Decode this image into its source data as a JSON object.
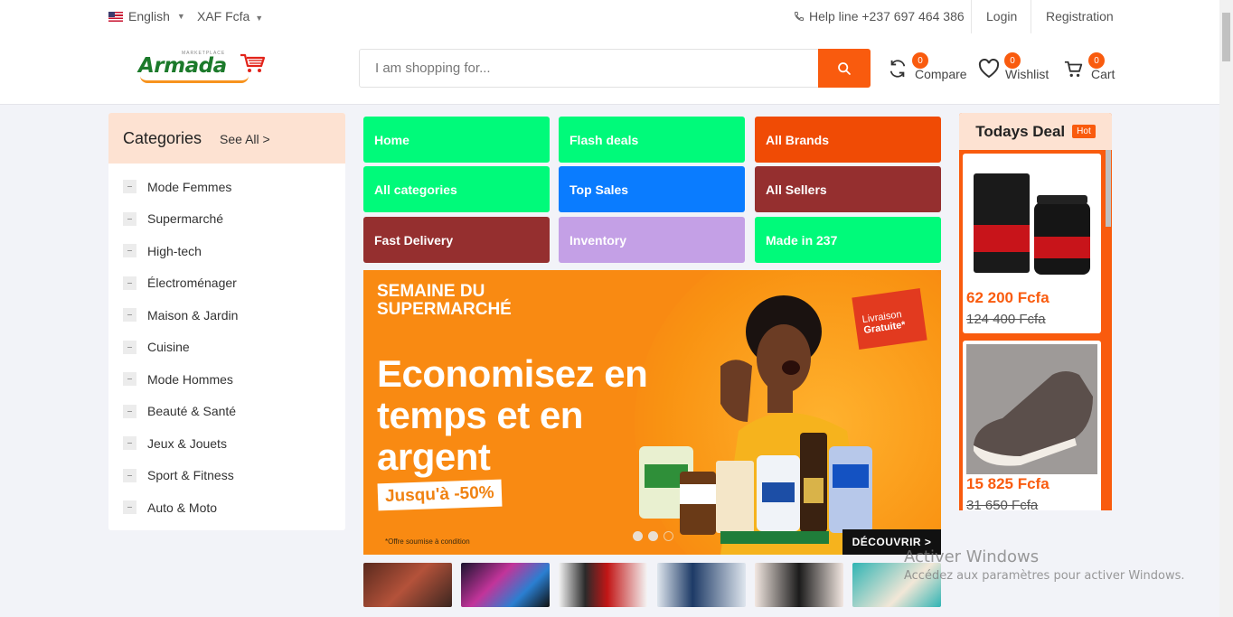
{
  "topbar": {
    "language": "English",
    "currency": "XAF Fcfa",
    "helpline": "Help line +237 697 464 386",
    "login": "Login",
    "registration": "Registration"
  },
  "header": {
    "logo_text": "Armada",
    "logo_tagline": "MARKETPLACE",
    "search_placeholder": "I am shopping for...",
    "compare": {
      "label": "Compare",
      "count": "0"
    },
    "wishlist": {
      "label": "Wishlist",
      "count": "0"
    },
    "cart": {
      "label": "Cart",
      "count": "0"
    }
  },
  "categories": {
    "title": "Categories",
    "see_all": "See All >",
    "items": [
      "Mode Femmes",
      "Supermarché",
      "High-tech",
      "Électroménager",
      "Maison & Jardin",
      "Cuisine",
      "Mode Hommes",
      "Beauté & Santé",
      "Jeux & Jouets",
      "Sport & Fitness",
      "Auto & Moto"
    ]
  },
  "nav_tiles": [
    {
      "label": "Home",
      "color": "#00fa7a"
    },
    {
      "label": "Flash deals",
      "color": "#00fa7a"
    },
    {
      "label": "All Brands",
      "color": "#f04b05"
    },
    {
      "label": "All categories",
      "color": "#00fa7a"
    },
    {
      "label": "Top Sales",
      "color": "#0a7cff"
    },
    {
      "label": "All Sellers",
      "color": "#952f2f"
    },
    {
      "label": "Fast Delivery",
      "color": "#952f2f"
    },
    {
      "label": "Inventory",
      "color": "#c4a0e6"
    },
    {
      "label": "Made in 237",
      "color": "#00fa7a"
    }
  ],
  "banner": {
    "headline_small": "SEMAINE DU SUPERMARCHÉ",
    "headline_big": "Economisez en temps et en argent",
    "discount": "Jusqu'à -50%",
    "note": "*Offre soumise à condition",
    "delivery_line1": "Livraison",
    "delivery_line2": "Gratuite*",
    "cta": "DÉCOUVRIR >"
  },
  "todays_deal": {
    "title": "Todays Deal",
    "badge": "Hot",
    "products": [
      {
        "price": "62 200 Fcfa",
        "old_price": "124 400 Fcfa"
      },
      {
        "price": "15 825 Fcfa",
        "old_price": "31 650 Fcfa"
      }
    ]
  },
  "watermark": {
    "line1": "Activer Windows",
    "line2": "Accédez aux paramètres pour activer Windows."
  },
  "colors": {
    "accent": "#f95b0e",
    "green_tile": "#00fa7a",
    "blue_tile": "#0a7cff",
    "maroon_tile": "#952f2f",
    "lavender_tile": "#c4a0e6"
  }
}
